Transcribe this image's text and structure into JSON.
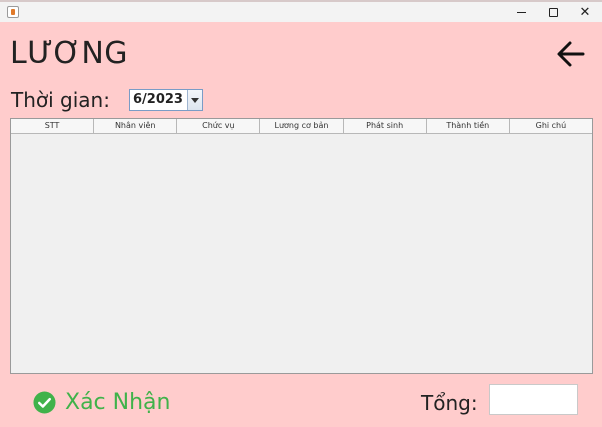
{
  "window": {
    "title": ""
  },
  "page": {
    "title": "LƯƠNG"
  },
  "period": {
    "label": "Thời gian:",
    "selected": "6/2023"
  },
  "table": {
    "columns": [
      "STT",
      "Nhân viên",
      "Chức vụ",
      "Lương cơ bản",
      "Phát sinh",
      "Thành tiền",
      "Ghi chú"
    ],
    "rows": []
  },
  "footer": {
    "confirm_label": "Xác Nhận",
    "total_label": "Tổng:",
    "total_value": ""
  },
  "icons": {
    "back": "arrow-left-icon",
    "confirm": "check-circle-icon",
    "app": "java-app-icon"
  },
  "colors": {
    "background": "#ffcccc",
    "confirm": "#40b24a",
    "table_bg": "#f0f0f0"
  }
}
